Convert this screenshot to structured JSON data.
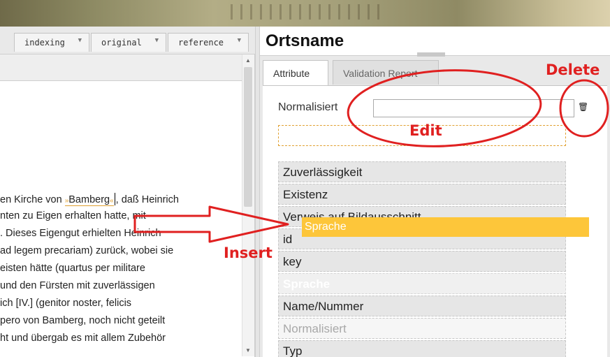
{
  "left": {
    "dropdowns": [
      {
        "label": "indexing"
      },
      {
        "label": "original"
      },
      {
        "label": "reference"
      }
    ],
    "text_lines": [
      {
        "before": "en Kirche von ",
        "highlight": "Bamberg",
        "after": ", daß Heinrich"
      },
      {
        "text": "nten zu Eigen erhalten hatte, mit"
      },
      {
        "text": ". Dieses Eigengut erhielten Heinrich"
      },
      {
        "text": "ad legem precariam) zurück, wobei sie"
      },
      {
        "text": "eisten hätte (quartus per militare"
      },
      {
        "text": " und den Fürsten mit zuverlässigen"
      },
      {
        "text": "ich [IV.] (genitor noster, felicis"
      },
      {
        "text": "pero von Bamberg, noch nicht geteilt"
      },
      {
        "text": "ht und übergab es mit allem Zubehör"
      }
    ],
    "marker_open": "»",
    "marker_close": "«"
  },
  "right": {
    "title": "Ortsname",
    "tabs": [
      {
        "label": "Attribute",
        "active": true
      },
      {
        "label": "Validation Report",
        "active": false
      }
    ],
    "normalisiert_label": "Normalisiert",
    "normalisiert_value": "",
    "delete_icon": "trash-icon",
    "items": [
      {
        "label": "Zuverlässigkeit",
        "style": "normal"
      },
      {
        "label": "Existenz",
        "style": "normal"
      },
      {
        "label": "Verweis auf Bildausschnitt",
        "style": "normal"
      },
      {
        "label": "id",
        "style": "normal"
      },
      {
        "label": "key",
        "style": "normal"
      },
      {
        "label": "Sprache",
        "style": "ghost"
      },
      {
        "label": "Name/Nummer",
        "style": "normal"
      },
      {
        "label": "Normalisiert",
        "style": "muted"
      },
      {
        "label": "Typ",
        "style": "normal"
      }
    ],
    "dragged_item": "Sprache"
  },
  "annotations": {
    "delete": "Delete",
    "edit": "Edit",
    "insert": "Insert",
    "color": "#e02020"
  },
  "colors": {
    "drag_accent": "#fdc63a",
    "dropzone_border": "#e0a030"
  }
}
